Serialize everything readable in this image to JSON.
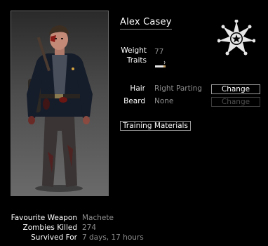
{
  "character": {
    "name": "Alex Casey"
  },
  "attributes": {
    "weight_label": "Weight",
    "weight_value": "77",
    "traits_label": "Traits",
    "trait_icon": "cigarette-icon"
  },
  "appearance": {
    "hair_label": "Hair",
    "hair_value": "Right Parting",
    "hair_button": "Change",
    "beard_label": "Beard",
    "beard_value": "None",
    "beard_button": "Change"
  },
  "training_button": "Training Materials",
  "badge_icon": "sheriff-star-icon",
  "stats": [
    {
      "label": "Favourite Weapon",
      "value": "Machete"
    },
    {
      "label": "Zombies Killed",
      "value": "274"
    },
    {
      "label": "Survived For",
      "value": "7 days, 17 hours"
    }
  ],
  "colors": {
    "background": "#000000",
    "text": "#ffffff",
    "muted": "#8f8f8f",
    "border": "#9a9a9a"
  }
}
